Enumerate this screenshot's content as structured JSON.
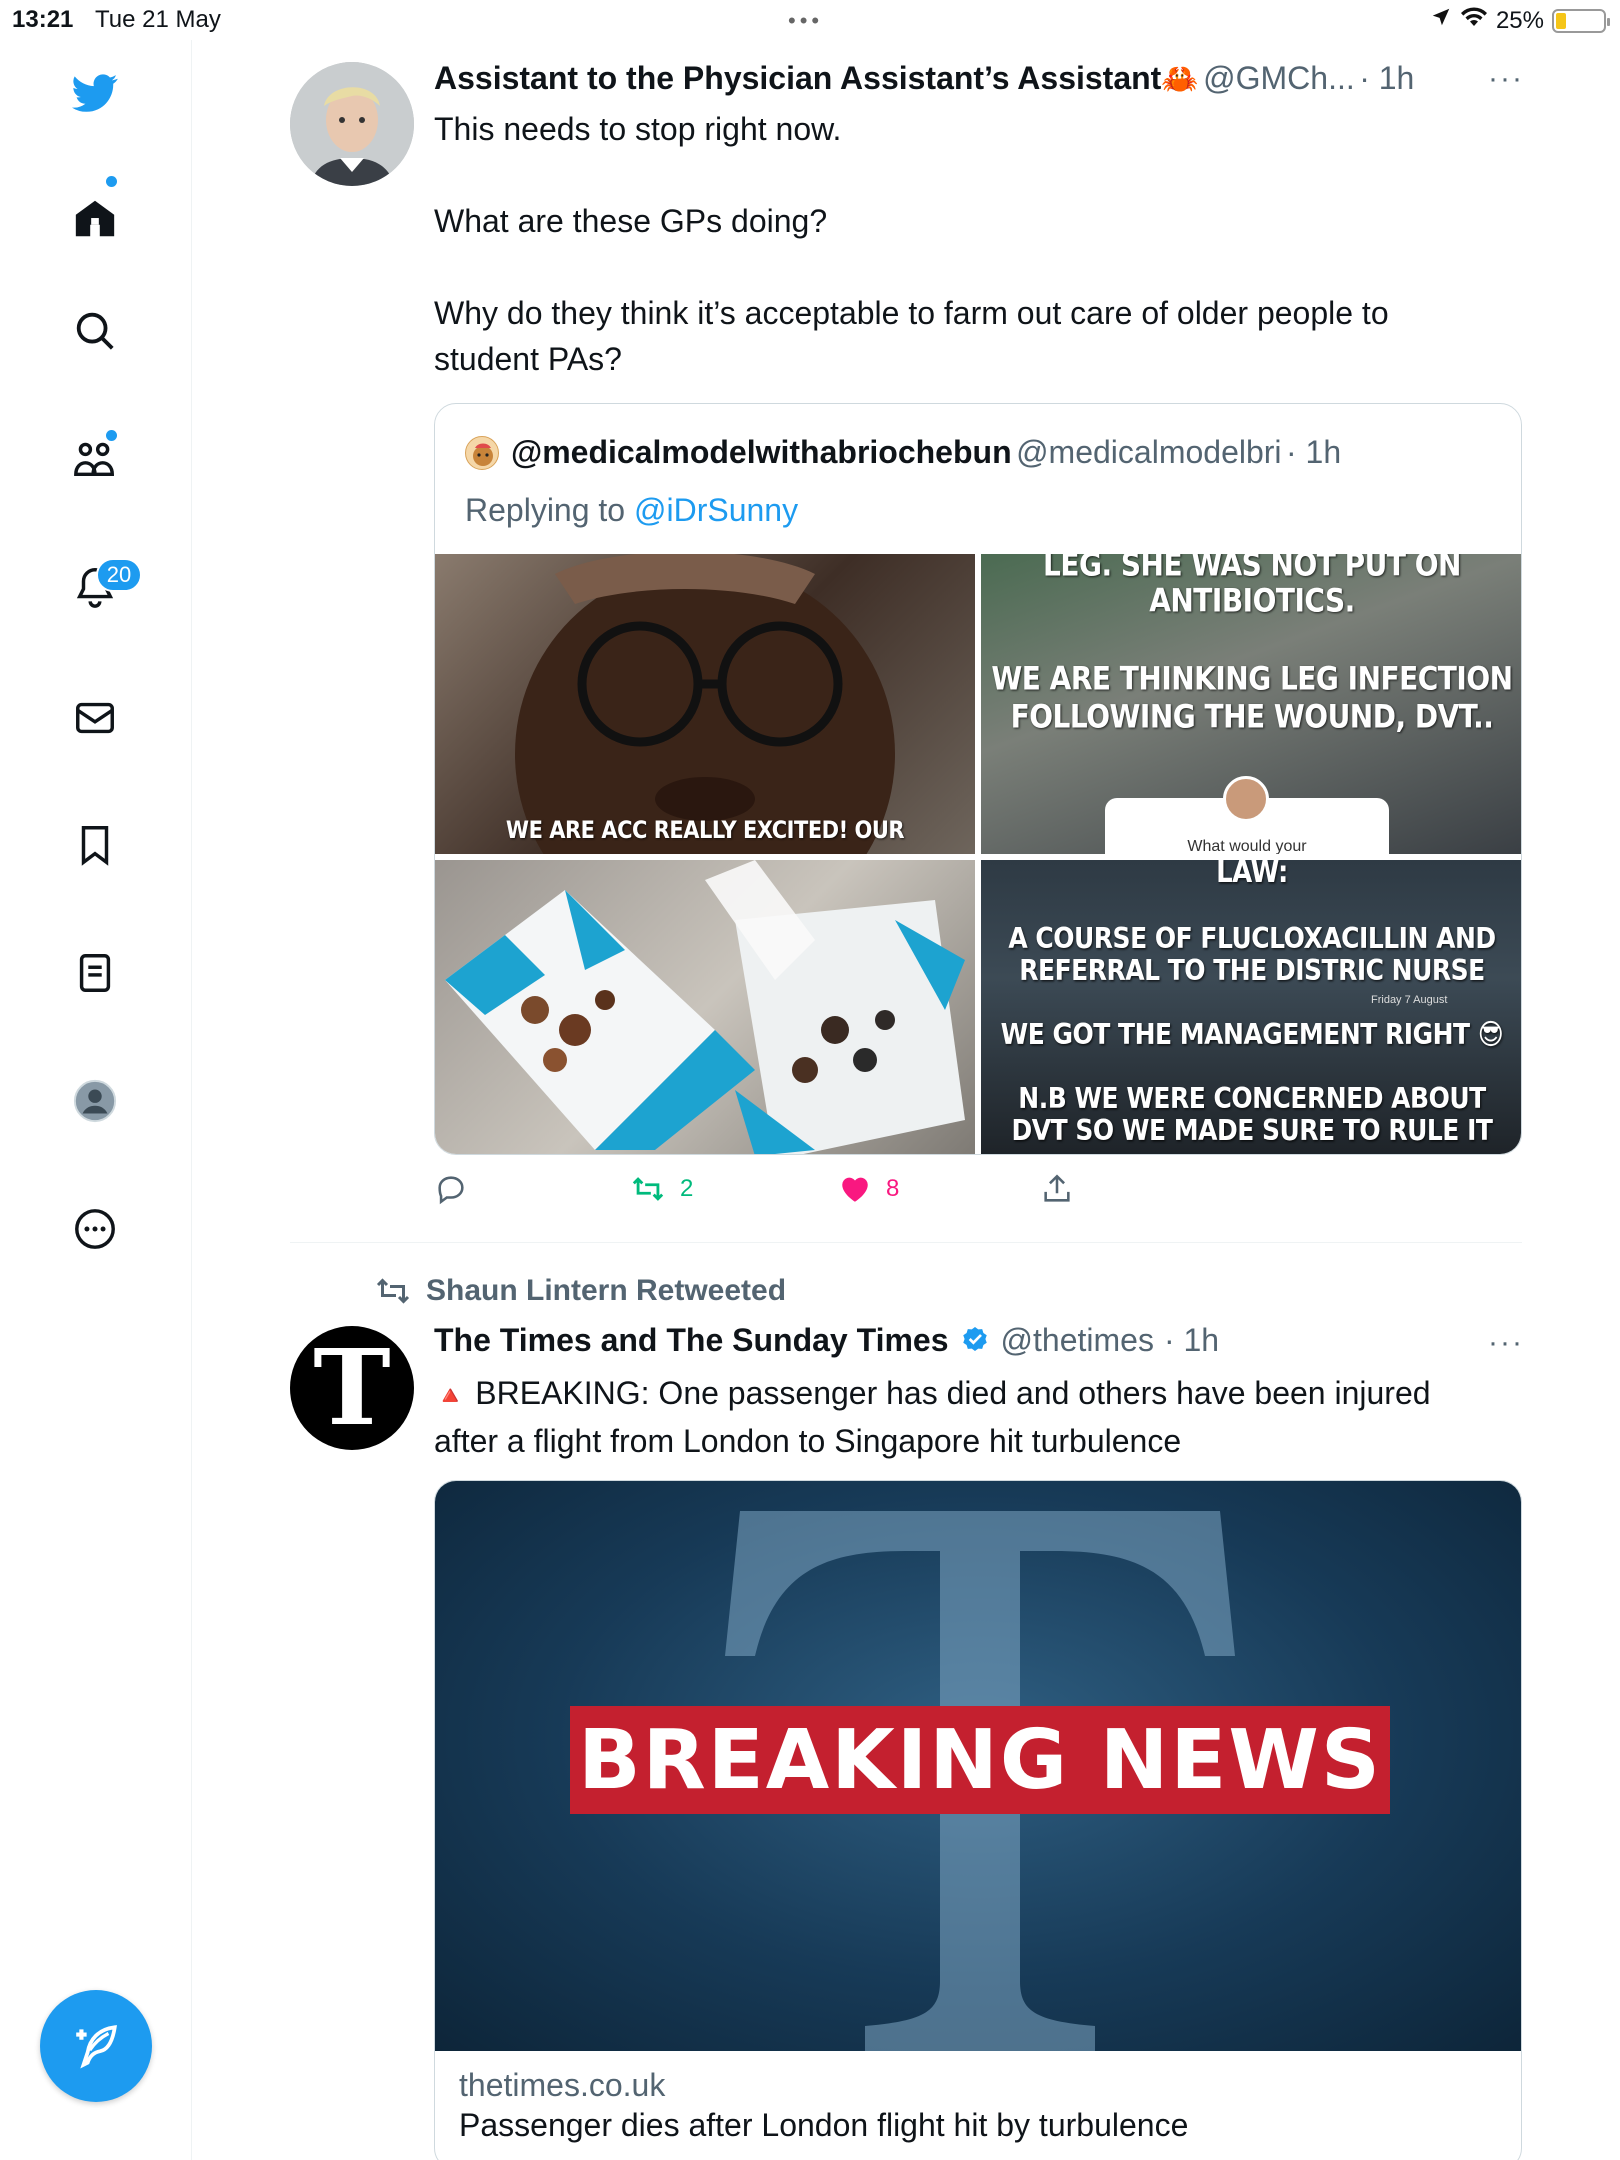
{
  "status_bar": {
    "time": "13:21",
    "date": "Tue 21 May",
    "battery": "25%"
  },
  "sidebar": {
    "notifications_badge": "20"
  },
  "tweet1": {
    "author_name": "Assistant to the Physician Assistant’s Assistant",
    "author_emoji": "🦀",
    "handle": "@GMCh...",
    "time": "· 1h",
    "text_lines": [
      "This needs to stop right now.",
      "What are these GPs doing?",
      "Why do they think it’s acceptable to farm out care of older people to",
      "student PAs?"
    ],
    "quote": {
      "author_name": "@medicalmodelwithabriochebun",
      "handle": "@medicalmodelbri",
      "time": "· 1h",
      "replying_label": "Replying to",
      "replying_handle": "@iDrSunny",
      "images": {
        "img1_text": "WE ARE ACC REALLY EXCITED! OUR",
        "img2_line1": "LEG. SHE WAS NOT PUT ON",
        "img2_line2": "ANTIBIOTICS.",
        "img2_line3": "WE ARE THINKING LEG INFECTION",
        "img2_line4": "FOLLOWING THE WOUND, DVT..",
        "img2_box": "What would your",
        "img4_line1": "LAW:",
        "img4_line2": "A COURSE OF FLUCLOXACILLIN AND",
        "img4_line3": "REFERRAL TO THE DISTRIC NURSE",
        "img4_small": "Friday 7 August",
        "img4_line4": "WE GOT THE MANAGEMENT RIGHT 😎",
        "img4_line5": "N.B WE WERE CONCERNED ABOUT",
        "img4_line6": "DVT SO WE MADE SURE TO RULE IT"
      }
    },
    "retweets": "2",
    "likes": "8"
  },
  "tweet2": {
    "retweeted_by": "Shaun Lintern Retweeted",
    "author_name": "The Times and The Sunday Times",
    "handle": "@thetimes",
    "time": "· 1h",
    "alert_icon": "🔺",
    "text_line1": "BREAKING: One passenger has died and others have been injured",
    "text_line2": "after a flight from London to Singapore hit turbulence",
    "avatar_letter": "T",
    "card": {
      "image_title": "BREAKING NEWS",
      "domain": "thetimes.co.uk",
      "title": "Passenger dies after London flight hit by turbulence"
    }
  },
  "colors": {
    "accent": "#1d9bf0",
    "like": "#f91880",
    "retweet": "#00ba7c",
    "breaking_red": "#c4202f"
  }
}
